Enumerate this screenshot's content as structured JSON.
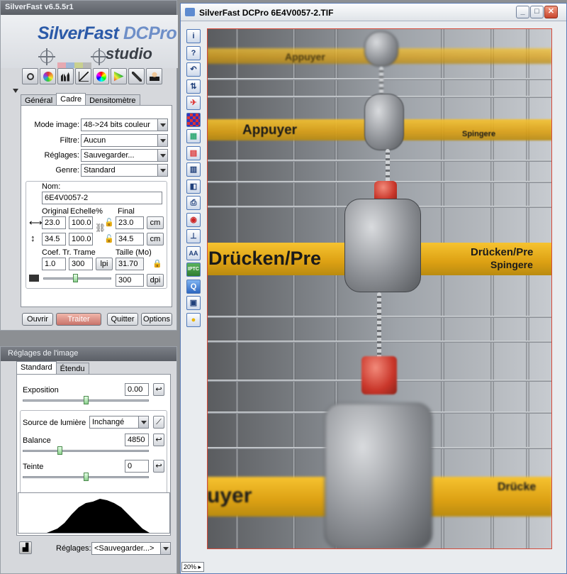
{
  "main_panel": {
    "title": "SilverFast v6.5.5r1",
    "logo_main": "SilverFast",
    "logo_edition": "DCPro",
    "logo_sub": "studio",
    "logo_swatches": [
      "#e6a9b1",
      "#9fb8d8",
      "#c9d08f",
      "#b8b8b8"
    ],
    "tools": [
      "zoom-icon",
      "aperture-icon",
      "histogram-icon",
      "curve-icon",
      "color-wheel-icon",
      "gradation-icon",
      "pipette-icon",
      "expert-icon"
    ],
    "tabs": [
      "Général",
      "Cadre",
      "Densitomètre"
    ],
    "active_tab": "Cadre",
    "mode_label": "Mode image:",
    "mode_value": "48->24 bits couleur",
    "filter_label": "Filtre:",
    "filter_value": "Aucun",
    "settings_label": "Réglages:",
    "settings_value": "Sauvegarder...",
    "genre_label": "Genre:",
    "genre_value": "Standard",
    "name_label": "Nom:",
    "name_value": "6E4V0057-2",
    "original_label": "Original",
    "scale_label": "Echelle%",
    "final_label": "Final",
    "width_original": "23.0",
    "width_scale": "100.0",
    "width_final": "23.0",
    "height_original": "34.5",
    "height_scale": "100.0",
    "height_final": "34.5",
    "unit_w": "cm",
    "unit_h": "cm",
    "coef_label": "Coef. Tr. Trame",
    "size_label": "Taille (Mo)",
    "coef_value": "1.0",
    "screen_value": "300",
    "screen_unit": "lpi",
    "size_value": "31.70",
    "resolution_value": "300",
    "resolution_unit": "dpi",
    "resolution_slider_fraction": 0.45,
    "buttons": {
      "open": "Ouvrir",
      "process": "Traiter",
      "quit": "Quitter",
      "options": "Options"
    }
  },
  "adjust_panel": {
    "title": "Réglages de l'image",
    "tabs": [
      "Standard",
      "Étendu"
    ],
    "exposure_label": "Exposition",
    "exposure_value": "0.00",
    "exposure_fraction": 0.5,
    "light_label": "Source de lumière",
    "light_value": "Inchangé",
    "balance_label": "Balance",
    "balance_value": "4850",
    "balance_fraction": 0.3,
    "tint_label": "Teinte",
    "tint_value": "0",
    "tint_fraction": 0.5,
    "settings_label": "Réglages:",
    "settings_value": "<Sauvegarder...>"
  },
  "image_window": {
    "title": "SilverFast DCPro 6E4V0057-2.TIF",
    "zoom": "20%",
    "side_tools": [
      "info-icon",
      "help-icon",
      "undo-icon",
      "transfer-icon",
      "airplane-icon",
      "grid-icon",
      "image-icon",
      "doc-icon",
      "page-icon",
      "split-icon",
      "print-icon",
      "eye-icon",
      "stamp-icon",
      "aa-icon",
      "iptc-icon",
      "q-icon",
      "scanner-icon",
      "bulb-icon"
    ],
    "photo_texts": [
      "Appuyer",
      "Appuyer",
      "Drücken/Pre",
      "Spingere",
      "Appuyer",
      "Drücken/Pre",
      "Spingere",
      "uyer",
      "Drücke"
    ]
  }
}
